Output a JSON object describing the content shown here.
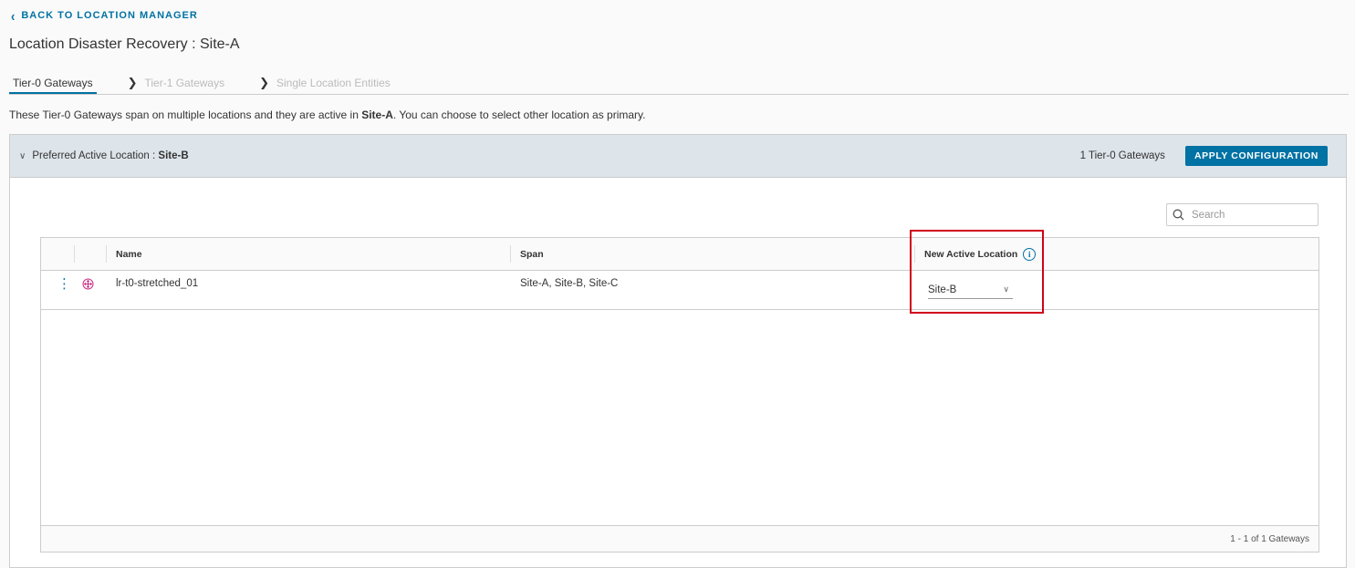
{
  "back_link": "BACK TO LOCATION MANAGER",
  "page_title": "Location Disaster Recovery : Site-A",
  "steps": [
    {
      "label": "Tier-0 Gateways"
    },
    {
      "label": "Tier-1 Gateways"
    },
    {
      "label": "Single Location Entities"
    }
  ],
  "description": {
    "before": "These Tier-0 Gateways span on multiple locations and they are active in ",
    "site": "Site-A",
    "after": ". You can choose to select other location as primary."
  },
  "panel": {
    "title_prefix": "Preferred Active Location : ",
    "title_site": "Site-B",
    "count": "1 Tier-0 Gateways",
    "apply_button": "APPLY CONFIGURATION"
  },
  "search": {
    "placeholder": "Search",
    "value": ""
  },
  "table": {
    "columns": {
      "name": "Name",
      "span": "Span",
      "new_active_location": "New Active Location"
    },
    "rows": [
      {
        "name": "lr-t0-stretched_01",
        "span": "Site-A, Site-B, Site-C",
        "new_active_location": "Site-B"
      }
    ],
    "footer": "1 - 1 of 1 Gateways"
  },
  "colors": {
    "accent": "#0072a3",
    "header_bg": "#dde4ea",
    "highlight": "#d0021b",
    "gateway_icon": "#c92f86"
  }
}
